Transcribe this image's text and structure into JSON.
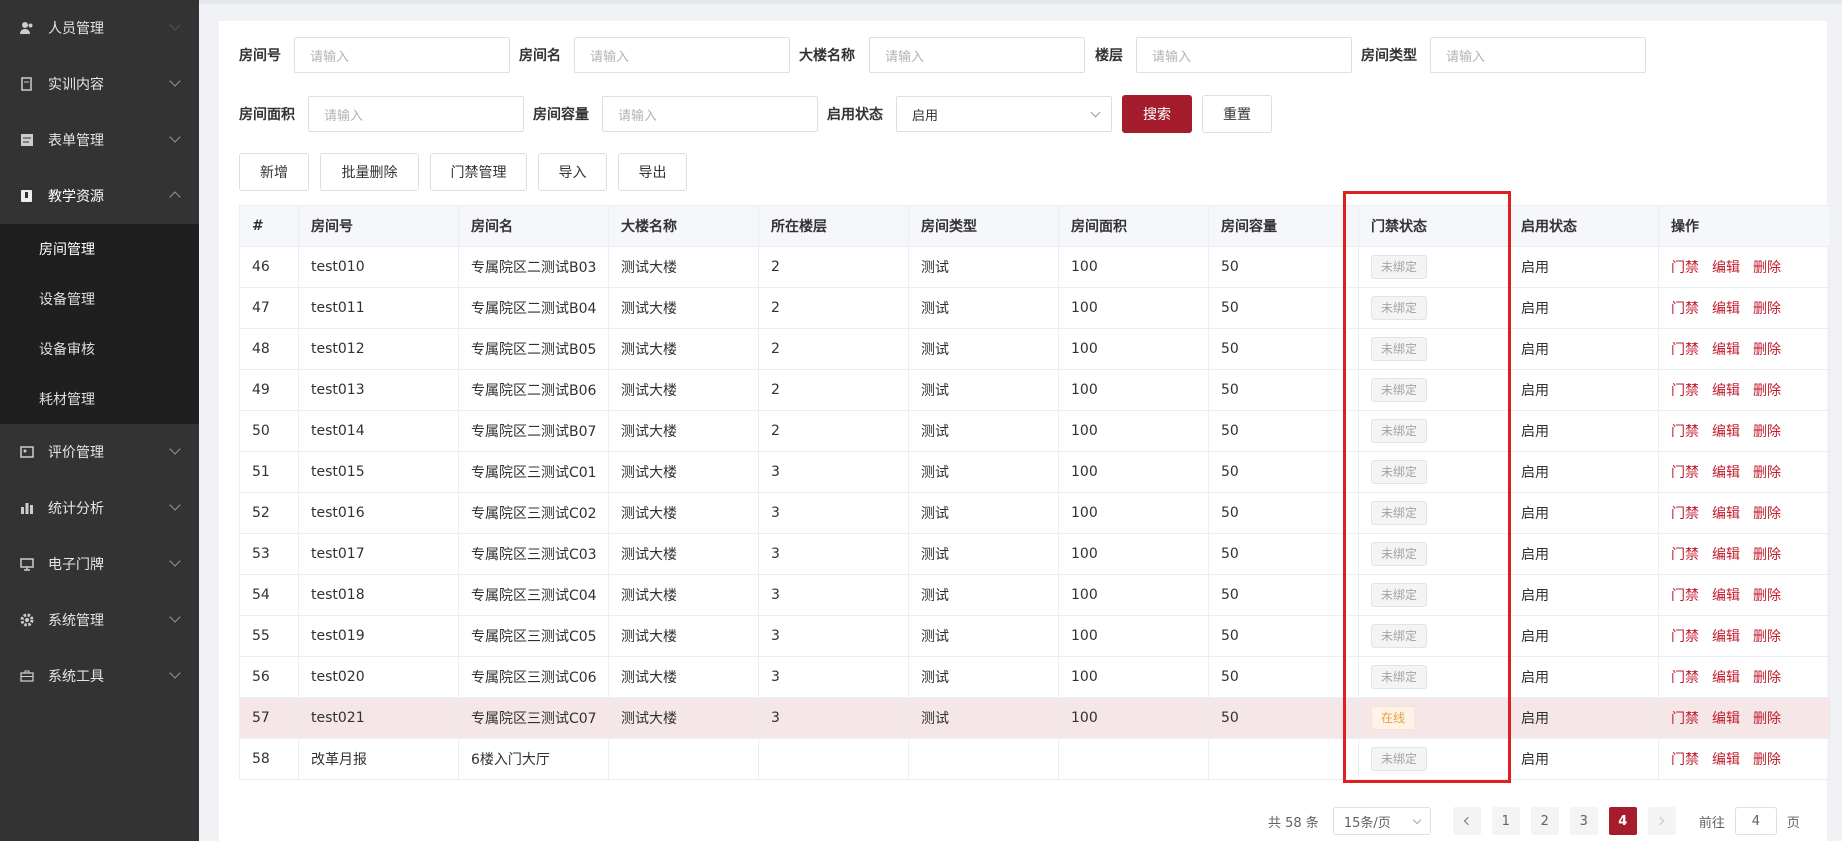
{
  "sidebar": {
    "items": [
      {
        "label": "人员管理",
        "icon": "users-icon"
      },
      {
        "label": "实训内容",
        "icon": "book-icon"
      },
      {
        "label": "表单管理",
        "icon": "form-icon"
      },
      {
        "label": "教学资源",
        "icon": "resource-icon"
      },
      {
        "label": "评价管理",
        "icon": "evaluation-icon"
      },
      {
        "label": "统计分析",
        "icon": "bar-chart-icon"
      },
      {
        "label": "电子门牌",
        "icon": "monitor-icon"
      },
      {
        "label": "系统管理",
        "icon": "gear-icon"
      },
      {
        "label": "系统工具",
        "icon": "toolbox-icon"
      }
    ],
    "sub_items": [
      {
        "label": "房间管理"
      },
      {
        "label": "设备管理"
      },
      {
        "label": "设备审核"
      },
      {
        "label": "耗材管理"
      }
    ]
  },
  "filters": {
    "room_no": {
      "label": "房间号",
      "placeholder": "请输入"
    },
    "room_name": {
      "label": "房间名",
      "placeholder": "请输入"
    },
    "building": {
      "label": "大楼名称",
      "placeholder": "请输入"
    },
    "floor": {
      "label": "楼层",
      "placeholder": "请输入"
    },
    "room_type": {
      "label": "房间类型",
      "placeholder": "请输入"
    },
    "area": {
      "label": "房间面积",
      "placeholder": "请输入"
    },
    "capacity": {
      "label": "房间容量",
      "placeholder": "请输入"
    },
    "status": {
      "label": "启用状态",
      "value": "启用"
    },
    "search_label": "搜索",
    "reset_label": "重置"
  },
  "toolbar": {
    "add": "新增",
    "batch_delete": "批量删除",
    "access_mgmt": "门禁管理",
    "import": "导入",
    "export": "导出"
  },
  "table": {
    "headers": [
      "#",
      "房间号",
      "房间名",
      "大楼名称",
      "所在楼层",
      "房间类型",
      "房间面积",
      "房间容量",
      "门禁状态",
      "启用状态",
      "操作"
    ],
    "actions": [
      "门禁",
      "编辑",
      "删除"
    ],
    "rows": [
      {
        "id": "46",
        "no": "test010",
        "name": "专属院区二测试B03",
        "building": "测试大楼",
        "floor": "2",
        "type": "测试",
        "area": "100",
        "cap": "50",
        "access": "未绑定",
        "status": "启用"
      },
      {
        "id": "47",
        "no": "test011",
        "name": "专属院区二测试B04",
        "building": "测试大楼",
        "floor": "2",
        "type": "测试",
        "area": "100",
        "cap": "50",
        "access": "未绑定",
        "status": "启用"
      },
      {
        "id": "48",
        "no": "test012",
        "name": "专属院区二测试B05",
        "building": "测试大楼",
        "floor": "2",
        "type": "测试",
        "area": "100",
        "cap": "50",
        "access": "未绑定",
        "status": "启用"
      },
      {
        "id": "49",
        "no": "test013",
        "name": "专属院区二测试B06",
        "building": "测试大楼",
        "floor": "2",
        "type": "测试",
        "area": "100",
        "cap": "50",
        "access": "未绑定",
        "status": "启用"
      },
      {
        "id": "50",
        "no": "test014",
        "name": "专属院区二测试B07",
        "building": "测试大楼",
        "floor": "2",
        "type": "测试",
        "area": "100",
        "cap": "50",
        "access": "未绑定",
        "status": "启用"
      },
      {
        "id": "51",
        "no": "test015",
        "name": "专属院区三测试C01",
        "building": "测试大楼",
        "floor": "3",
        "type": "测试",
        "area": "100",
        "cap": "50",
        "access": "未绑定",
        "status": "启用"
      },
      {
        "id": "52",
        "no": "test016",
        "name": "专属院区三测试C02",
        "building": "测试大楼",
        "floor": "3",
        "type": "测试",
        "area": "100",
        "cap": "50",
        "access": "未绑定",
        "status": "启用"
      },
      {
        "id": "53",
        "no": "test017",
        "name": "专属院区三测试C03",
        "building": "测试大楼",
        "floor": "3",
        "type": "测试",
        "area": "100",
        "cap": "50",
        "access": "未绑定",
        "status": "启用"
      },
      {
        "id": "54",
        "no": "test018",
        "name": "专属院区三测试C04",
        "building": "测试大楼",
        "floor": "3",
        "type": "测试",
        "area": "100",
        "cap": "50",
        "access": "未绑定",
        "status": "启用"
      },
      {
        "id": "55",
        "no": "test019",
        "name": "专属院区三测试C05",
        "building": "测试大楼",
        "floor": "3",
        "type": "测试",
        "area": "100",
        "cap": "50",
        "access": "未绑定",
        "status": "启用"
      },
      {
        "id": "56",
        "no": "test020",
        "name": "专属院区三测试C06",
        "building": "测试大楼",
        "floor": "3",
        "type": "测试",
        "area": "100",
        "cap": "50",
        "access": "未绑定",
        "status": "启用"
      },
      {
        "id": "57",
        "no": "test021",
        "name": "专属院区三测试C07",
        "building": "测试大楼",
        "floor": "3",
        "type": "测试",
        "area": "100",
        "cap": "50",
        "access": "在线",
        "status": "启用"
      },
      {
        "id": "58",
        "no": "改革月报",
        "name": "6楼入门大厅",
        "building": "",
        "floor": "",
        "type": "",
        "area": "",
        "cap": "",
        "access": "未绑定",
        "status": "启用"
      }
    ]
  },
  "pagination": {
    "total": "共 58 条",
    "page_size": "15条/页",
    "pages": [
      "1",
      "2",
      "3",
      "4"
    ],
    "current": "4",
    "goto_label": "前往",
    "goto_value": "4",
    "page_suffix": "页"
  },
  "colors": {
    "primary": "#a51d2d",
    "sidebar_bg": "#333333",
    "highlight_box": "#e02020"
  }
}
